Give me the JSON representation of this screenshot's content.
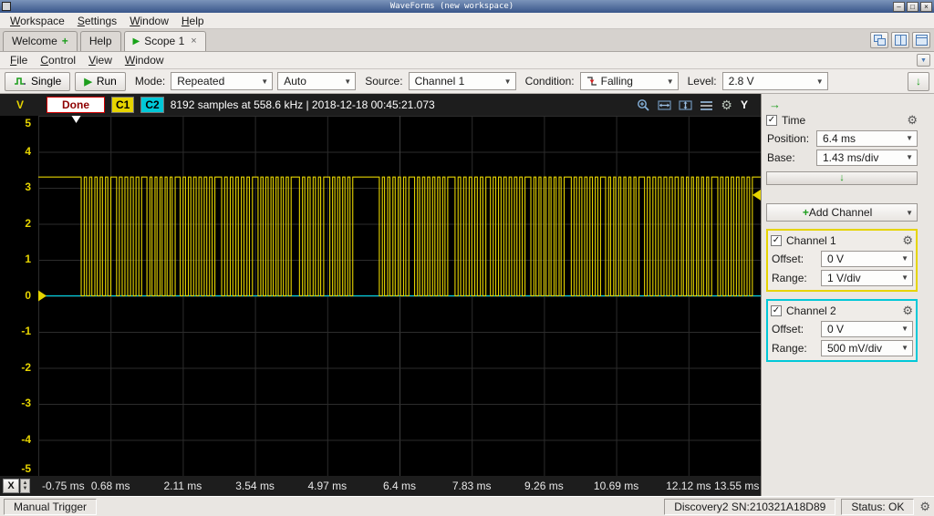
{
  "titlebar": {
    "title": "WaveForms (new workspace)"
  },
  "menubar": {
    "items": [
      "Workspace",
      "Settings",
      "Window",
      "Help"
    ]
  },
  "tabbar": {
    "welcome_label": "Welcome",
    "help_label": "Help",
    "scope_label": "Scope 1"
  },
  "scope_menubar": {
    "items": [
      "File",
      "Control",
      "View",
      "Window"
    ]
  },
  "toolbar": {
    "single_label": "Single",
    "run_label": "Run",
    "mode_label": "Mode:",
    "mode_value": "Repeated",
    "auto_value": "Auto",
    "source_label": "Source:",
    "source_value": "Channel 1",
    "condition_label": "Condition:",
    "condition_value": "Falling",
    "level_label": "Level:",
    "level_value": "2.8 V"
  },
  "scope_header": {
    "y_unit": "V",
    "status": "Done",
    "c1_badge": "C1",
    "c2_badge": "C2",
    "info": "8192 samples at 558.6 kHz | 2018-12-18 00:45:21.073",
    "axis_button": "Y"
  },
  "plot": {
    "x_button": "X",
    "y_labels": [
      5,
      4,
      3,
      2,
      1,
      0,
      -1,
      -2,
      -3,
      -4,
      -5
    ],
    "x_labels": [
      "-0.75 ms",
      "0.68 ms",
      "2.11 ms",
      "3.54 ms",
      "4.97 ms",
      "6.4 ms",
      "7.83 ms",
      "9.26 ms",
      "10.69 ms",
      "12.12 ms",
      "13.55 ms"
    ],
    "time_start_ms": -0.75,
    "time_end_ms": 13.55,
    "volt_min": -5,
    "volt_max": 5,
    "ch1_high_v": 3.3,
    "ch1_low_v": 0,
    "ch2_level_v": 0,
    "trigger_level_v": 2.8,
    "trigger_time_ms": 0,
    "colors": {
      "ch1": "#e6d400",
      "ch2": "#00c8d8",
      "grid": "#2c2c2c",
      "grid_center": "#3d3d3d",
      "bg": "#000000"
    },
    "ch1_bursts": [
      [
        0.1,
        6,
        0.105,
        0.06
      ],
      [
        0.8,
        5,
        0.11,
        0.055
      ],
      [
        1.4,
        6,
        0.1,
        0.06
      ],
      [
        2.06,
        7,
        0.105,
        0.055
      ],
      [
        2.88,
        6,
        0.11,
        0.06
      ],
      [
        3.6,
        7,
        0.1,
        0.055
      ],
      [
        4.42,
        5,
        0.105,
        0.06
      ],
      [
        5.02,
        5,
        0.1,
        0.055
      ],
      [
        6.0,
        6,
        0.105,
        0.06
      ],
      [
        6.7,
        7,
        0.1,
        0.055
      ],
      [
        7.5,
        6,
        0.11,
        0.06
      ],
      [
        8.2,
        7,
        0.105,
        0.055
      ],
      [
        9.0,
        7,
        0.1,
        0.06
      ],
      [
        9.8,
        6,
        0.105,
        0.055
      ],
      [
        10.48,
        7,
        0.1,
        0.06
      ],
      [
        11.25,
        6,
        0.11,
        0.055
      ],
      [
        11.92,
        7,
        0.1,
        0.06
      ],
      [
        12.7,
        7,
        0.105,
        0.055
      ]
    ]
  },
  "sidebar": {
    "time": {
      "label": "Time",
      "position_label": "Position:",
      "position_value": "6.4 ms",
      "base_label": "Base:",
      "base_value": "1.43 ms/div"
    },
    "add_channel_label": "Add Channel",
    "channel1": {
      "label": "Channel 1",
      "offset_label": "Offset:",
      "offset_value": "0 V",
      "range_label": "Range:",
      "range_value": "1 V/div"
    },
    "channel2": {
      "label": "Channel 2",
      "offset_label": "Offset:",
      "offset_value": "0 V",
      "range_label": "Range:",
      "range_value": "500 mV/div"
    }
  },
  "statusbar": {
    "trigger_mode": "Manual Trigger",
    "device": "Discovery2 SN:210321A18D89",
    "status": "Status: OK"
  }
}
